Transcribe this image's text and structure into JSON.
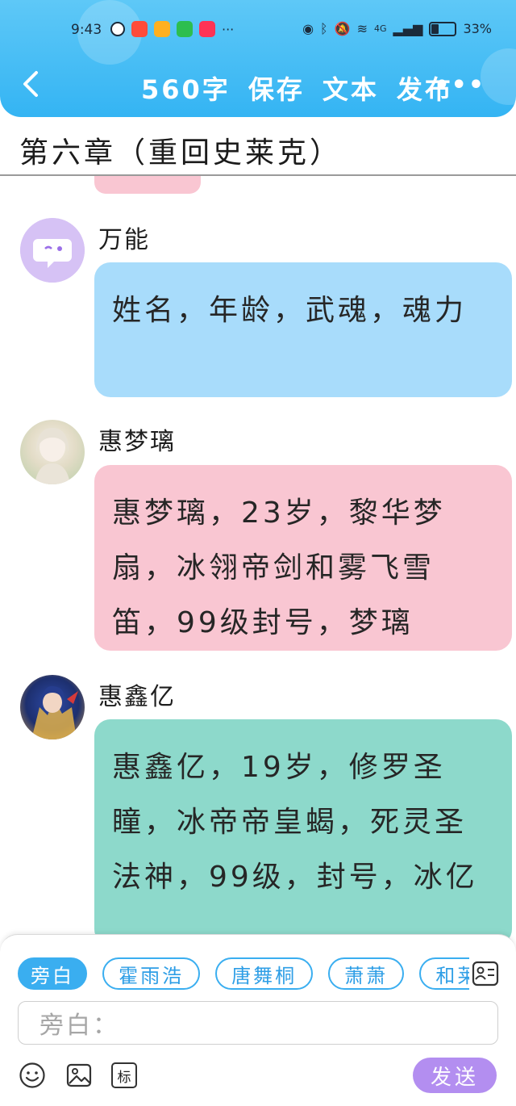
{
  "status_bar": {
    "time": "9:43",
    "network": "4G",
    "battery": "33%",
    "battery_level": 0.33
  },
  "header": {
    "back_icon": "chevron-left-icon",
    "word_count": "560字",
    "save_label": "保存",
    "text_label": "文本",
    "publish_label": "发布",
    "more_icon": "more-horizontal-icon",
    "colors": {
      "bar": "#34b4f3",
      "text": "#ffffff"
    }
  },
  "chapter": {
    "title": "第六章（重回史莱克）"
  },
  "messages": [
    {
      "sender": "万能",
      "avatar": "chat-bot-avatar",
      "text": "姓名，年龄，武魂，魂力",
      "bubble_color": "#a8dcfb"
    },
    {
      "sender": "惠梦璃",
      "avatar": "anime-girl-avatar",
      "text": "惠梦璃，23岁，黎华梦扇，冰翎帝剑和雾飞雪笛，99级封号，梦璃",
      "bubble_color": "#f9c6d2"
    },
    {
      "sender": "惠鑫亿",
      "avatar": "anime-boy-avatar",
      "text": "惠鑫亿，19岁，修罗圣瞳，冰帝帝皇蝎，死灵圣法神，99级，封号，冰亿",
      "bubble_color": "#8dd9cb"
    }
  ],
  "composer": {
    "roles": [
      "旁白",
      "霍雨浩",
      "唐舞桐",
      "萧萧",
      "和莱"
    ],
    "active_role": "旁白",
    "input_placeholder": "旁白：",
    "tool_emoji_icon": "emoji-icon",
    "tool_image_icon": "image-icon",
    "tool_tag_label": "标",
    "send_label": "发送",
    "colors": {
      "chip": "#3aaef0",
      "send": "#b38ef0"
    }
  }
}
